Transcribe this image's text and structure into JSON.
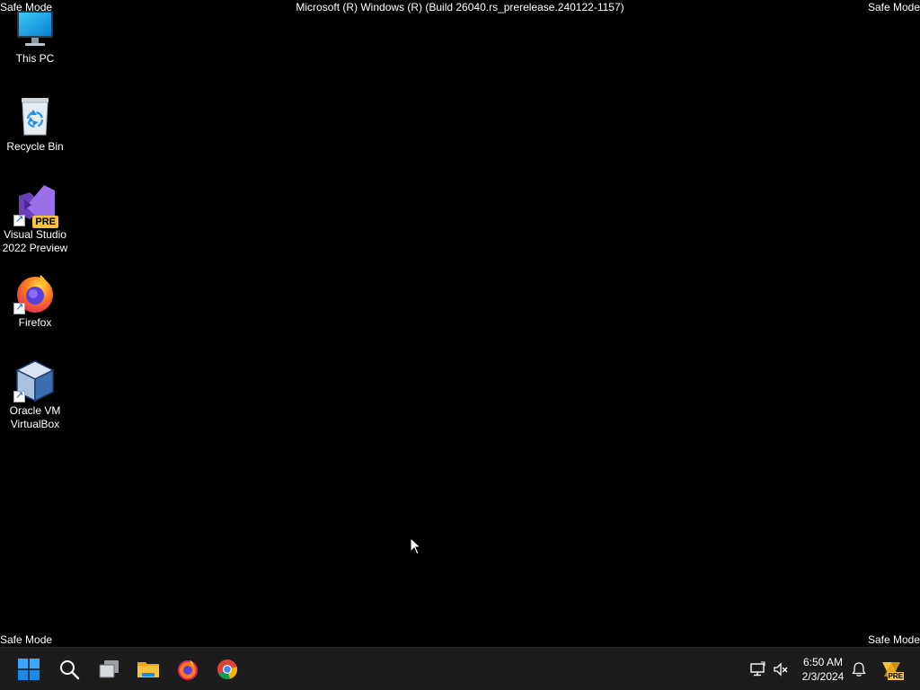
{
  "overlay": {
    "safe_mode": "Safe Mode",
    "build": "Microsoft (R) Windows (R) (Build 26040.rs_prerelease.240122-1157)"
  },
  "desktop_icons": [
    {
      "label": "This PC",
      "icon": "monitor-icon"
    },
    {
      "label": "Recycle Bin",
      "icon": "recycle-bin-icon"
    },
    {
      "label": "Visual Studio 2022 Preview",
      "icon": "visual-studio-icon",
      "badge": "PRE"
    },
    {
      "label": "Firefox",
      "icon": "firefox-icon"
    },
    {
      "label": "Oracle VM VirtualBox",
      "icon": "virtualbox-icon"
    }
  ],
  "taskbar": {
    "apps": [
      "start-icon",
      "search-icon",
      "task-view-icon",
      "file-explorer-icon",
      "firefox-icon",
      "chrome-icon"
    ],
    "tray": [
      "network-icon",
      "volume-muted-icon",
      "notification-bell-icon",
      "dev-badge-icon"
    ],
    "clock": {
      "time": "6:50 AM",
      "date": "2/3/2024"
    },
    "dev_badge": "PRE"
  },
  "colors": {
    "desktop_bg": "#000000",
    "taskbar_bg": "#1c1c1c",
    "windows_blue": "#0a84d8",
    "vs_purple": "#8b5fd6",
    "folder_yellow": "#f5c23e"
  }
}
